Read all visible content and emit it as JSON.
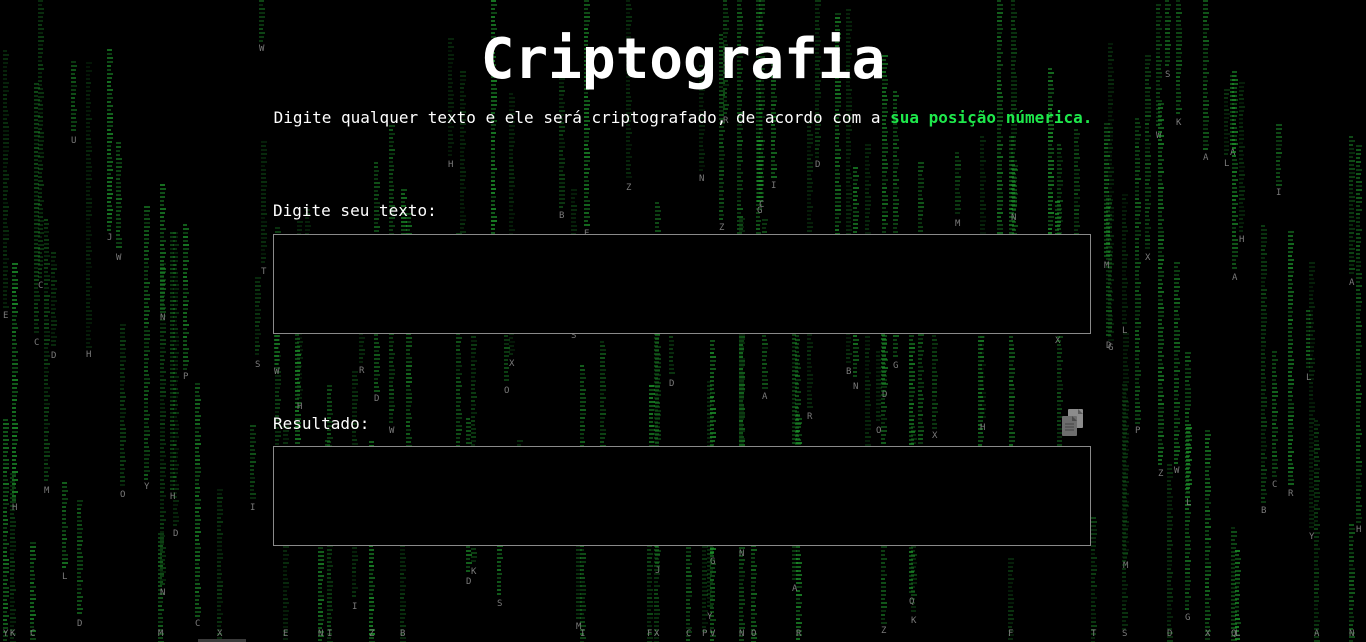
{
  "page": {
    "title": "Criptografia",
    "subtitle_text": "Digite qualquer texto e ele será criptografado, de acordo com a ",
    "subtitle_highlight": "sua posição númerica."
  },
  "input_section": {
    "label": "Digite seu texto:",
    "value": "",
    "placeholder": ""
  },
  "result_section": {
    "label": "Resultado:",
    "value": ""
  },
  "icons": {
    "copy": "copy-icon"
  },
  "colors": {
    "background": "#000000",
    "matrix_green": "#1f9e2e",
    "highlight_green": "#1ee84b",
    "text": "#ffffff",
    "box_border": "#8a8a8a"
  }
}
